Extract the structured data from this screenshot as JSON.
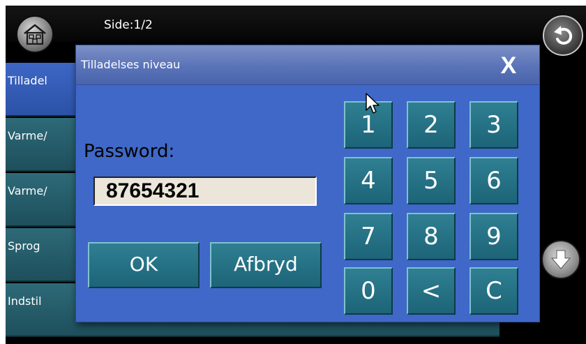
{
  "header": {
    "side_label": "Side:1/2",
    "home_icon": "home-icon",
    "back_icon": "undo-icon"
  },
  "menu": {
    "items": [
      {
        "label": "Tilladel"
      },
      {
        "label": "Varme/"
      },
      {
        "label": "Varme/"
      },
      {
        "label": "Sprog"
      },
      {
        "label": "Indstil"
      }
    ]
  },
  "scroll": {
    "down_icon": "arrow-down-icon"
  },
  "dialog": {
    "title": "Tilladelses niveau",
    "close_label": "X",
    "password_label": "Password:",
    "password_value": "87654321",
    "ok_label": "OK",
    "cancel_label": "Afbryd",
    "keys": [
      "1",
      "2",
      "3",
      "4",
      "5",
      "6",
      "7",
      "8",
      "9",
      "0",
      "<",
      "C"
    ]
  },
  "colors": {
    "dialog_bg": "#3f68c8",
    "button_teal": "#2a7589",
    "menu_item": "#2a6472"
  }
}
